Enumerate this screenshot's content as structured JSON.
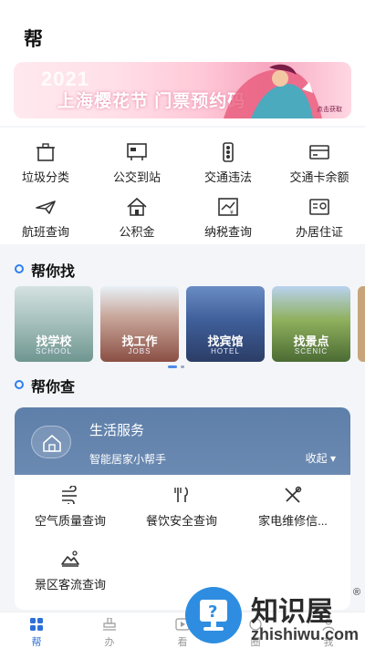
{
  "header": {
    "title": "帮"
  },
  "banner": {
    "year": "2021",
    "title": "上海樱花节  门票预约码",
    "cta": "点击获取"
  },
  "grid": [
    {
      "label": "垃圾分类",
      "icon": "trash-bin-icon"
    },
    {
      "label": "公交到站",
      "icon": "bus-screen-icon"
    },
    {
      "label": "交通违法",
      "icon": "traffic-light-icon"
    },
    {
      "label": "交通卡余额",
      "icon": "transit-card-icon"
    },
    {
      "label": "航班查询",
      "icon": "plane-icon"
    },
    {
      "label": "公积金",
      "icon": "house-fund-icon"
    },
    {
      "label": "纳税查询",
      "icon": "tax-chart-icon"
    },
    {
      "label": "办居住证",
      "icon": "id-card-icon"
    }
  ],
  "find": {
    "title": "帮你找",
    "cards": [
      {
        "name": "找学校",
        "en": "SCHOOL"
      },
      {
        "name": "找工作",
        "en": "JOBS"
      },
      {
        "name": "找宾馆",
        "en": "HOTEL"
      },
      {
        "name": "找景点",
        "en": "SCENIC"
      }
    ]
  },
  "check": {
    "title": "帮你查",
    "panel": {
      "title": "生活服务",
      "subtitle": "智能居家小帮手",
      "toggle": "收起 ▾",
      "items": [
        {
          "label": "空气质量查询",
          "icon": "air-quality-icon"
        },
        {
          "label": "餐饮安全查询",
          "icon": "dining-icon"
        },
        {
          "label": "家电维修信...",
          "icon": "repair-tools-icon"
        },
        {
          "label": "景区客流查询",
          "icon": "scenic-crowd-icon"
        }
      ]
    }
  },
  "tabs": [
    {
      "label": "帮",
      "active": true
    },
    {
      "label": "办",
      "active": false
    },
    {
      "label": "看",
      "active": false
    },
    {
      "label": "圈",
      "active": false
    },
    {
      "label": "我",
      "active": false
    }
  ],
  "watermark": {
    "big": "知识屋",
    "small": "zhishiwu.com",
    "reg": "®"
  },
  "colors": {
    "accent": "#2d7ff0",
    "panel_header": "#6b8ab2",
    "tab_active": "#2d6fd6"
  }
}
